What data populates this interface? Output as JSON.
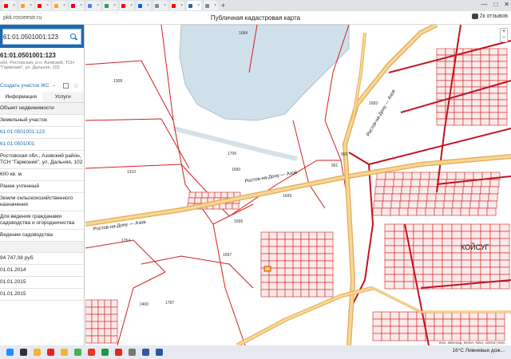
{
  "browser": {
    "tabs": [
      {
        "icon": "yandex-icon",
        "color": "#ff0000",
        "label": "",
        "active": false
      },
      {
        "icon": "kinopoisk-icon",
        "color": "#f5a623",
        "label": "",
        "active": false
      },
      {
        "icon": "yandex-icon",
        "color": "#ff0000",
        "label": "",
        "active": false
      },
      {
        "icon": "kinopoisk-icon",
        "color": "#f5a623",
        "label": "",
        "active": false
      },
      {
        "icon": "pinterest-icon",
        "color": "#e60023",
        "label": "",
        "active": false
      },
      {
        "icon": "google-icon",
        "color": "#4285f4",
        "label": "",
        "active": false
      },
      {
        "icon": "generic-icon",
        "color": "#2d9d4b",
        "label": "",
        "active": false
      },
      {
        "icon": "youtube-icon",
        "color": "#ff0000",
        "label": "",
        "active": false
      },
      {
        "icon": "ozon-icon",
        "color": "#005bff",
        "label": "",
        "active": false
      },
      {
        "icon": "generic-icon",
        "color": "#888888",
        "label": "",
        "active": false
      },
      {
        "icon": "yandex-icon",
        "color": "#ff0000",
        "label": "",
        "active": false
      },
      {
        "icon": "pkk-icon",
        "color": "#1e6ab1",
        "label": "",
        "active": true
      },
      {
        "icon": "generic-icon",
        "color": "#888888",
        "label": "",
        "active": false
      }
    ],
    "url": "pkk.rosreestr.ru",
    "page_title": "Публичная кадастровая карта",
    "reviews": "2к отзывов"
  },
  "panel": {
    "search_value": "61:01.0501001:123",
    "cad_number": "61:01.0501001:123",
    "address_short": "обл. Ростовская, р-н. Азовский, ТСН \"Гармония\", ул. Дальняя, 102",
    "add_link": "Создать участок ЖС →",
    "tabs": [
      "Информация",
      "Услуги"
    ],
    "rows": [
      {
        "text": "Объект недвижимости",
        "style": "grey"
      },
      {
        "text": "Земельный участок",
        "style": ""
      },
      {
        "text": "61:01:0501001:123",
        "style": "blue"
      },
      {
        "text": "61:01:0501001",
        "style": "blue"
      },
      {
        "text": "Ростовская обл., Азовский район, ТСН \"Гармония\", ул. Дальняя, 102",
        "style": ""
      },
      {
        "text": "600 кв. м",
        "style": ""
      },
      {
        "text": "Ранее учтенный",
        "style": ""
      },
      {
        "text": "Земли сельскохозяйственного назначения",
        "style": ""
      },
      {
        "text": "Для ведения гражданами садоводства и огородничества",
        "style": ""
      },
      {
        "text": "Ведение садоводства",
        "style": ""
      },
      {
        "text": "",
        "style": "grey"
      },
      {
        "text": "94 747,08 руб.",
        "style": ""
      },
      {
        "text": "01.01.2014",
        "style": ""
      },
      {
        "text": "01.01.2015",
        "style": ""
      },
      {
        "text": "01.01.2015",
        "style": ""
      }
    ]
  },
  "map": {
    "road_labels": [
      "Ростов-на-Дону — Азов",
      "Ростов-на-Дону — Азов",
      "Ростов-на-Дону — Азов"
    ],
    "place_label": "КОЙСУГ",
    "parcel_labels": [
      "1684",
      "1308",
      "1706",
      "1690",
      "1310",
      "1699",
      "1696",
      "1754",
      "1697",
      "1787",
      "2400",
      "960",
      "961",
      "1683"
    ],
    "attribution": "Esri, Intermap, NASA, NGA, USGS | Esri"
  },
  "taskbar": {
    "icons": [
      {
        "name": "windows-start-icon",
        "color": "#1e90ff"
      },
      {
        "name": "search-icon",
        "color": "#333333"
      },
      {
        "name": "file-explorer-icon",
        "color": "#f2b632"
      },
      {
        "name": "yandex-browser-icon",
        "color": "#e52620"
      },
      {
        "name": "file-manager-icon",
        "color": "#f2b632"
      },
      {
        "name": "chrome-icon",
        "color": "#4caf50"
      },
      {
        "name": "opera-icon",
        "color": "#e6372b"
      },
      {
        "name": "bank-icon",
        "color": "#1d9a43"
      },
      {
        "name": "yandex-icon",
        "color": "#e52620"
      },
      {
        "name": "generic-icon",
        "color": "#777777"
      },
      {
        "name": "r-icon",
        "color": "#2f58a0"
      },
      {
        "name": "word-icon",
        "color": "#2b5797"
      }
    ],
    "weather": "16°C Ливневые дож...",
    "time": "",
    "date": ""
  }
}
